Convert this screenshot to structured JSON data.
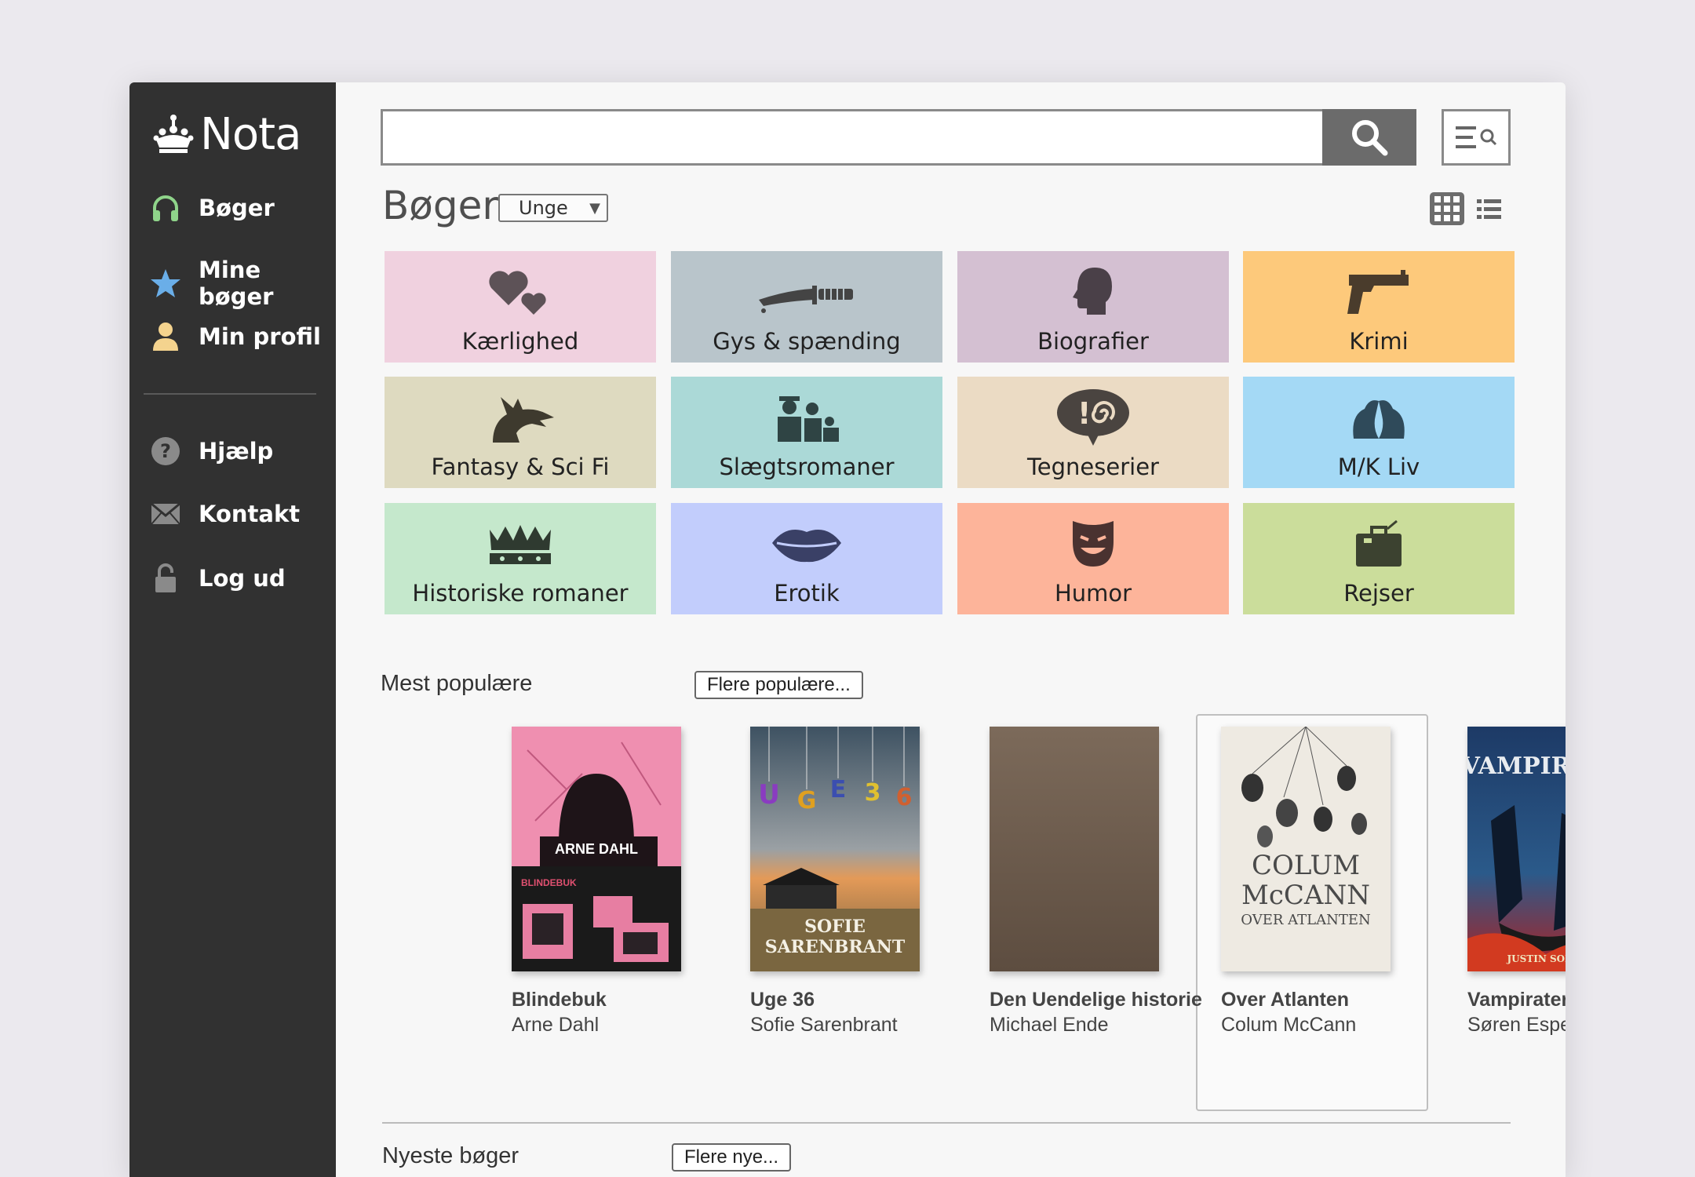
{
  "app": {
    "logo_text": "Nota"
  },
  "sidebar": {
    "items": [
      {
        "label": "Bøger",
        "icon": "headphones-icon"
      },
      {
        "label": "Mine bøger",
        "icon": "star-icon"
      },
      {
        "label": "Min profil",
        "icon": "person-icon"
      },
      {
        "label": "Hjælp",
        "icon": "help-icon"
      },
      {
        "label": "Kontakt",
        "icon": "envelope-icon"
      },
      {
        "label": "Log ud",
        "icon": "lock-icon"
      }
    ]
  },
  "search": {
    "value": "",
    "placeholder": ""
  },
  "page": {
    "title": "Bøger",
    "audience_selected": "Unge"
  },
  "genres": [
    {
      "label": "Kærlighed",
      "icon": "hearts-icon",
      "color": "#f0d1df"
    },
    {
      "label": "Gys & spænding",
      "icon": "knife-icon",
      "color": "#b9c5cb"
    },
    {
      "label": "Biografier",
      "icon": "head-profile-icon",
      "color": "#d4c0d2"
    },
    {
      "label": "Krimi",
      "icon": "pistol-icon",
      "color": "#fdc97b"
    },
    {
      "label": "Fantasy & Sci Fi",
      "icon": "dragon-icon",
      "color": "#dedac0"
    },
    {
      "label": "Slægtsromaner",
      "icon": "family-icon",
      "color": "#abd9d7"
    },
    {
      "label": "Tegneserier",
      "icon": "speech-bubble-icon",
      "color": "#ebdbc4"
    },
    {
      "label": "M/K Liv",
      "icon": "couple-icon",
      "color": "#a4d9f5"
    },
    {
      "label": "Historiske romaner",
      "icon": "crown-icon",
      "color": "#c5e8cc"
    },
    {
      "label": "Erotik",
      "icon": "lips-icon",
      "color": "#c2cdfc"
    },
    {
      "label": "Humor",
      "icon": "smiling-mask-icon",
      "color": "#fdb49a"
    },
    {
      "label": "Rejser",
      "icon": "suitcase-icon",
      "color": "#cbdd9b"
    }
  ],
  "popular": {
    "label": "Mest populære",
    "more_label": "Flere populære...",
    "books": [
      {
        "title": "Blindebuk",
        "author": "Arne Dahl",
        "cover_text": [
          "ARNE DAHL",
          "BLINDEBUK"
        ]
      },
      {
        "title": "Uge 36",
        "author": "Sofie Sarenbrant",
        "cover_text": [
          "U",
          "G",
          "E",
          "3",
          "6",
          "SOFIE",
          "SARENBRANT"
        ]
      },
      {
        "title": "Den Uendelige historie",
        "author": "Michael Ende",
        "cover_text": []
      },
      {
        "title": "Over Atlanten",
        "author": "Colum McCann",
        "cover_text": [
          "COLUM",
          "McCANN",
          "OVER ATLANTEN"
        ]
      },
      {
        "title": "Vampirater",
        "author": "Søren Espersen",
        "cover_text": [
          "VAMPIRATER",
          "JUSTIN SOMPER"
        ]
      }
    ]
  },
  "newest": {
    "label": "Nyeste bøger",
    "more_label": "Flere nye..."
  }
}
